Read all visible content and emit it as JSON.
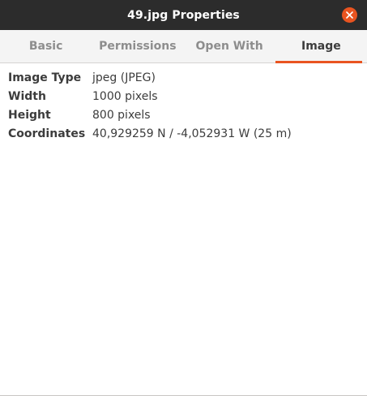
{
  "window": {
    "title": "49.jpg Properties",
    "accent_color": "#e95420",
    "close_icon": "close-icon"
  },
  "tabs": [
    {
      "label": "Basic",
      "active": false
    },
    {
      "label": "Permissions",
      "active": false
    },
    {
      "label": "Open With",
      "active": false
    },
    {
      "label": "Image",
      "active": true
    }
  ],
  "image_properties": [
    {
      "key": "Image Type",
      "value": "jpeg (JPEG)"
    },
    {
      "key": "Width",
      "value": "1000 pixels"
    },
    {
      "key": "Height",
      "value": "800 pixels"
    },
    {
      "key": "Coordinates",
      "value": "40,929259 N / -4,052931 W (25 m)"
    }
  ]
}
